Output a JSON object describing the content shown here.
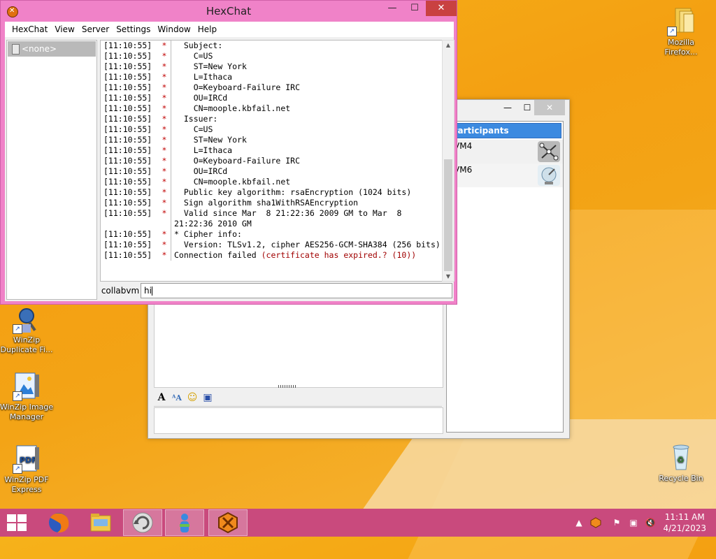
{
  "hexchat": {
    "title": "HexChat",
    "menu": [
      "HexChat",
      "View",
      "Server",
      "Settings",
      "Window",
      "Help"
    ],
    "tree_item": "<none>",
    "nick": "collabvm",
    "input_value": "hi",
    "log": [
      {
        "ts": "[11:10:55]",
        "nick": "*",
        "msg": "  Subject:"
      },
      {
        "ts": "[11:10:55]",
        "nick": "*",
        "msg": "    C=US"
      },
      {
        "ts": "[11:10:55]",
        "nick": "*",
        "msg": "    ST=New York"
      },
      {
        "ts": "[11:10:55]",
        "nick": "*",
        "msg": "    L=Ithaca"
      },
      {
        "ts": "[11:10:55]",
        "nick": "*",
        "msg": "    O=Keyboard-Failure IRC"
      },
      {
        "ts": "[11:10:55]",
        "nick": "*",
        "msg": "    OU=IRCd"
      },
      {
        "ts": "[11:10:55]",
        "nick": "*",
        "msg": "    CN=moople.kbfail.net"
      },
      {
        "ts": "[11:10:55]",
        "nick": "*",
        "msg": "  Issuer:"
      },
      {
        "ts": "[11:10:55]",
        "nick": "*",
        "msg": "    C=US"
      },
      {
        "ts": "[11:10:55]",
        "nick": "*",
        "msg": "    ST=New York"
      },
      {
        "ts": "[11:10:55]",
        "nick": "*",
        "msg": "    L=Ithaca"
      },
      {
        "ts": "[11:10:55]",
        "nick": "*",
        "msg": "    O=Keyboard-Failure IRC"
      },
      {
        "ts": "[11:10:55]",
        "nick": "*",
        "msg": "    OU=IRCd"
      },
      {
        "ts": "[11:10:55]",
        "nick": "*",
        "msg": "    CN=moople.kbfail.net"
      },
      {
        "ts": "[11:10:55]",
        "nick": "*",
        "msg": "  Public key algorithm: rsaEncryption (1024 bits)"
      },
      {
        "ts": "[11:10:55]",
        "nick": "*",
        "msg": "  Sign algorithm sha1WithRSAEncryption"
      },
      {
        "ts": "[11:10:55]",
        "nick": "*",
        "msg": "  Valid since Mar  8 21:22:36 2009 GM to Mar  8 21:22:36 2010 GM"
      },
      {
        "ts": "[11:10:55]",
        "nick": "*",
        "msg": "* Cipher info:"
      },
      {
        "ts": "[11:10:55]",
        "nick": "*",
        "msg": "  Version: TLSv1.2, cipher AES256-GCM-SHA384 (256 bits)"
      }
    ],
    "last_line": {
      "ts": "[11:10:55]",
      "nick": "*",
      "msg_prefix": "Connection failed ",
      "msg_error": "(certificate has expired.? (10))"
    }
  },
  "collab": {
    "participants_header": "Participants",
    "participants": [
      {
        "name": "VM4",
        "icon": "network-icon"
      },
      {
        "name": "VM6",
        "icon": "satellite-icon"
      }
    ]
  },
  "desktop_icons": [
    {
      "label": "Mozilla Firefox...",
      "icon": "folder-icon"
    },
    {
      "label": "WinZip Duplicate Fi...",
      "icon": "winzip-duplicate-icon"
    },
    {
      "label": "WinZip Image Manager",
      "icon": "winzip-image-icon"
    },
    {
      "label": "WinZip PDF Express",
      "icon": "pdf-icon"
    },
    {
      "label": "Recycle Bin",
      "icon": "recycle-bin-icon"
    }
  ],
  "taskbar": {
    "time": "11:11 AM",
    "date": "4/21/2023"
  }
}
